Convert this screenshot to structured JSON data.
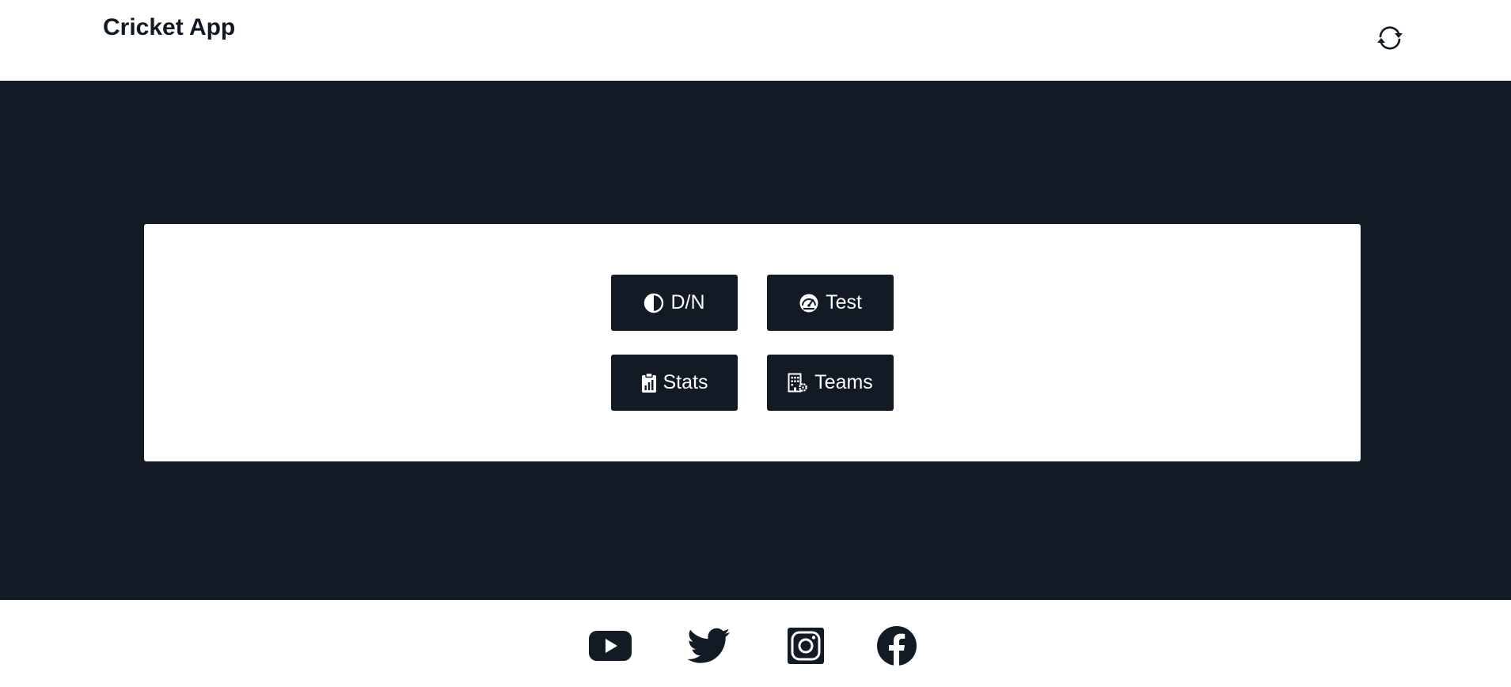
{
  "app": {
    "title": "Cricket App"
  },
  "header": {
    "refresh_icon": "refresh-icon"
  },
  "menu": {
    "buttons": [
      {
        "label": "D/N",
        "icon": "contrast-icon"
      },
      {
        "label": "Test",
        "icon": "speedometer-icon"
      },
      {
        "label": "Stats",
        "icon": "clipboard-chart-icon"
      },
      {
        "label": "Teams",
        "icon": "building-gear-icon"
      }
    ]
  },
  "footer": {
    "social": [
      {
        "icon": "youtube-icon"
      },
      {
        "icon": "twitter-icon"
      },
      {
        "icon": "instagram-icon"
      },
      {
        "icon": "facebook-icon"
      }
    ]
  },
  "colors": {
    "dark": "#111a25",
    "light": "#ffffff"
  }
}
